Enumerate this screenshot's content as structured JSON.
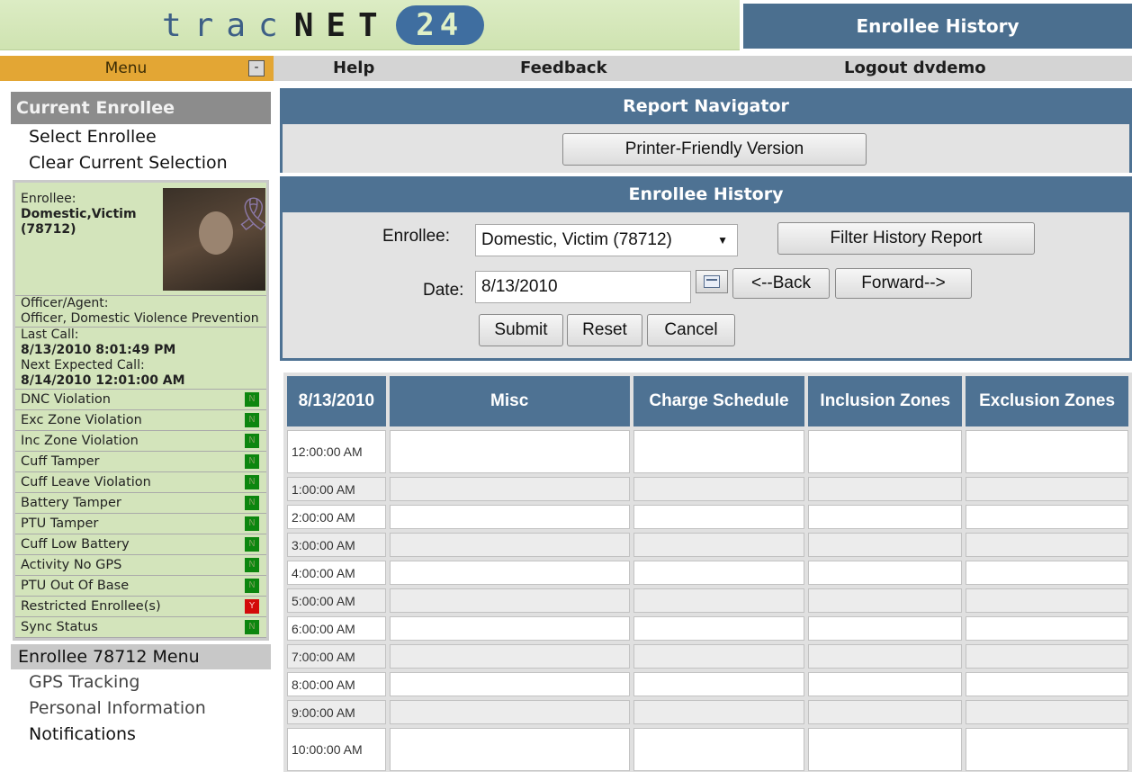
{
  "header": {
    "logo": {
      "low": "trac",
      "net": "NET",
      "badge": "24"
    },
    "page_title": "Enrollee History"
  },
  "menubar": {
    "menu": "Menu",
    "toggle": "-",
    "help": "Help",
    "feedback": "Feedback",
    "logout": "Logout dvdemo"
  },
  "sidebar": {
    "current_header": "Current Enrollee",
    "select": "Select Enrollee",
    "clear": "Clear Current Selection",
    "enrollee_label": "Enrollee:",
    "enrollee_name": "Domestic,Victim",
    "enrollee_id": "(78712)",
    "officer_label": "Officer/Agent:",
    "officer_name": "Officer, Domestic Violence Prevention",
    "last_call_label": "Last Call:",
    "last_call": "8/13/2010 8:01:49 PM",
    "next_call_label": "Next Expected Call:",
    "next_call": "8/14/2010 12:01:00 AM",
    "statuses": [
      {
        "label": "DNC Violation",
        "flag": "N"
      },
      {
        "label": "Exc Zone Violation",
        "flag": "N"
      },
      {
        "label": "Inc Zone Violation",
        "flag": "N"
      },
      {
        "label": "Cuff Tamper",
        "flag": "N"
      },
      {
        "label": "Cuff Leave Violation",
        "flag": "N"
      },
      {
        "label": "Battery Tamper",
        "flag": "N"
      },
      {
        "label": "PTU Tamper",
        "flag": "N"
      },
      {
        "label": "Cuff Low Battery",
        "flag": "N"
      },
      {
        "label": "Activity No GPS",
        "flag": "N"
      },
      {
        "label": "PTU Out Of Base",
        "flag": "N"
      },
      {
        "label": "Restricted Enrollee(s)",
        "flag": "Y"
      },
      {
        "label": "Sync Status",
        "flag": "N"
      }
    ],
    "enrollee_menu_header": "Enrollee 78712 Menu",
    "enrollee_menu": [
      "GPS Tracking",
      "Personal Information",
      "Notifications"
    ]
  },
  "report_navigator": {
    "header": "Report Navigator",
    "printer_button": "Printer-Friendly Version"
  },
  "history_form": {
    "header": "Enrollee History",
    "enrollee_label": "Enrollee:",
    "enrollee_value": "Domestic, Victim (78712)",
    "filter_button": "Filter History Report",
    "date_label": "Date:",
    "date_value": "8/13/2010",
    "back_button": "<--Back",
    "forward_button": "Forward-->",
    "submit_button": "Submit",
    "reset_button": "Reset",
    "cancel_button": "Cancel"
  },
  "history_table": {
    "columns": [
      "8/13/2010",
      "Misc",
      "Charge Schedule",
      "Inclusion Zones",
      "Exclusion Zones"
    ],
    "rows": [
      "12:00:00 AM",
      "1:00:00 AM",
      "2:00:00 AM",
      "3:00:00 AM",
      "4:00:00 AM",
      "5:00:00 AM",
      "6:00:00 AM",
      "7:00:00 AM",
      "8:00:00 AM",
      "9:00:00 AM",
      "10:00:00 AM"
    ]
  },
  "colors": {
    "header_blue": "#4e7293",
    "menu_orange": "#e3a634",
    "status_ok": "#0c860f",
    "status_alert": "#d30a0a",
    "sidebar_green": "#d3e4bb"
  }
}
